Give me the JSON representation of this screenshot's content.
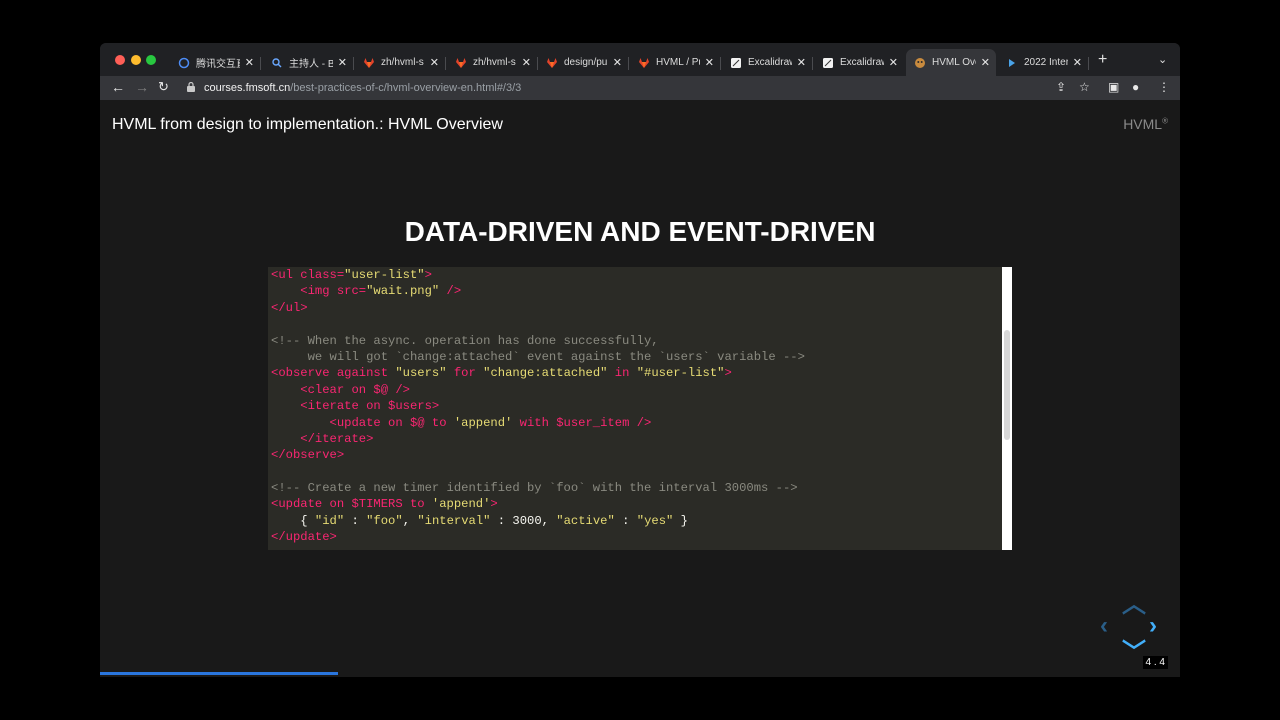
{
  "tabs": [
    {
      "label": "腾讯交互直播",
      "favicon": "tencent-icon"
    },
    {
      "label": "主持人 - Bi",
      "favicon": "search-icon"
    },
    {
      "label": "zh/hvml-s",
      "favicon": "gitlab-icon"
    },
    {
      "label": "zh/hvml-s",
      "favicon": "gitlab-icon"
    },
    {
      "label": "design/pu",
      "favicon": "gitlab-icon"
    },
    {
      "label": "HVML / Pu",
      "favicon": "gitlab-icon"
    },
    {
      "label": "Excalidraw",
      "favicon": "excalidraw-icon"
    },
    {
      "label": "Excalidraw",
      "favicon": "excalidraw-icon"
    },
    {
      "label": "HVML Ove",
      "favicon": "hvml-icon",
      "active": true
    },
    {
      "label": "2022 Inter",
      "favicon": "arrow-icon"
    }
  ],
  "address": {
    "host": "courses.fmsoft.cn",
    "path": "/best-practices-of-c/hvml-overview-en.html#/3/3"
  },
  "slide": {
    "header_title": "HVML from design to implementation.: HVML Overview",
    "brand": "HVML",
    "brand_mark": "®",
    "title": "DATA-DRIVEN AND EVENT-DRIVEN",
    "code_lines": [
      "<ul class=\"user-list\">",
      "    <img src=\"wait.png\" />",
      "</ul>",
      "",
      "<!-- When the async. operation has done successfully,",
      "     we will got `change:attached` event against the `users` variable -->",
      "<observe against \"users\" for \"change:attached\" in \"#user-list\">",
      "    <clear on $@ />",
      "    <iterate on $users>",
      "        <update on $@ to 'append' with $user_item />",
      "    </iterate>",
      "</observe>",
      "",
      "<!-- Create a new timer identified by `foo` with the interval 3000ms -->",
      "<update on $TIMERS to 'append'>",
      "    { \"id\" : \"foo\", \"interval\" : 3000, \"active\" : \"yes\" }",
      "</update>"
    ],
    "slide_number": "4 . 4"
  },
  "colors": {
    "tag": "#f92672",
    "string": "#e6db74",
    "comment": "#8a8a80",
    "progress": "#2a76dd",
    "controls": "#42affa"
  },
  "progress_fraction": 0.22
}
